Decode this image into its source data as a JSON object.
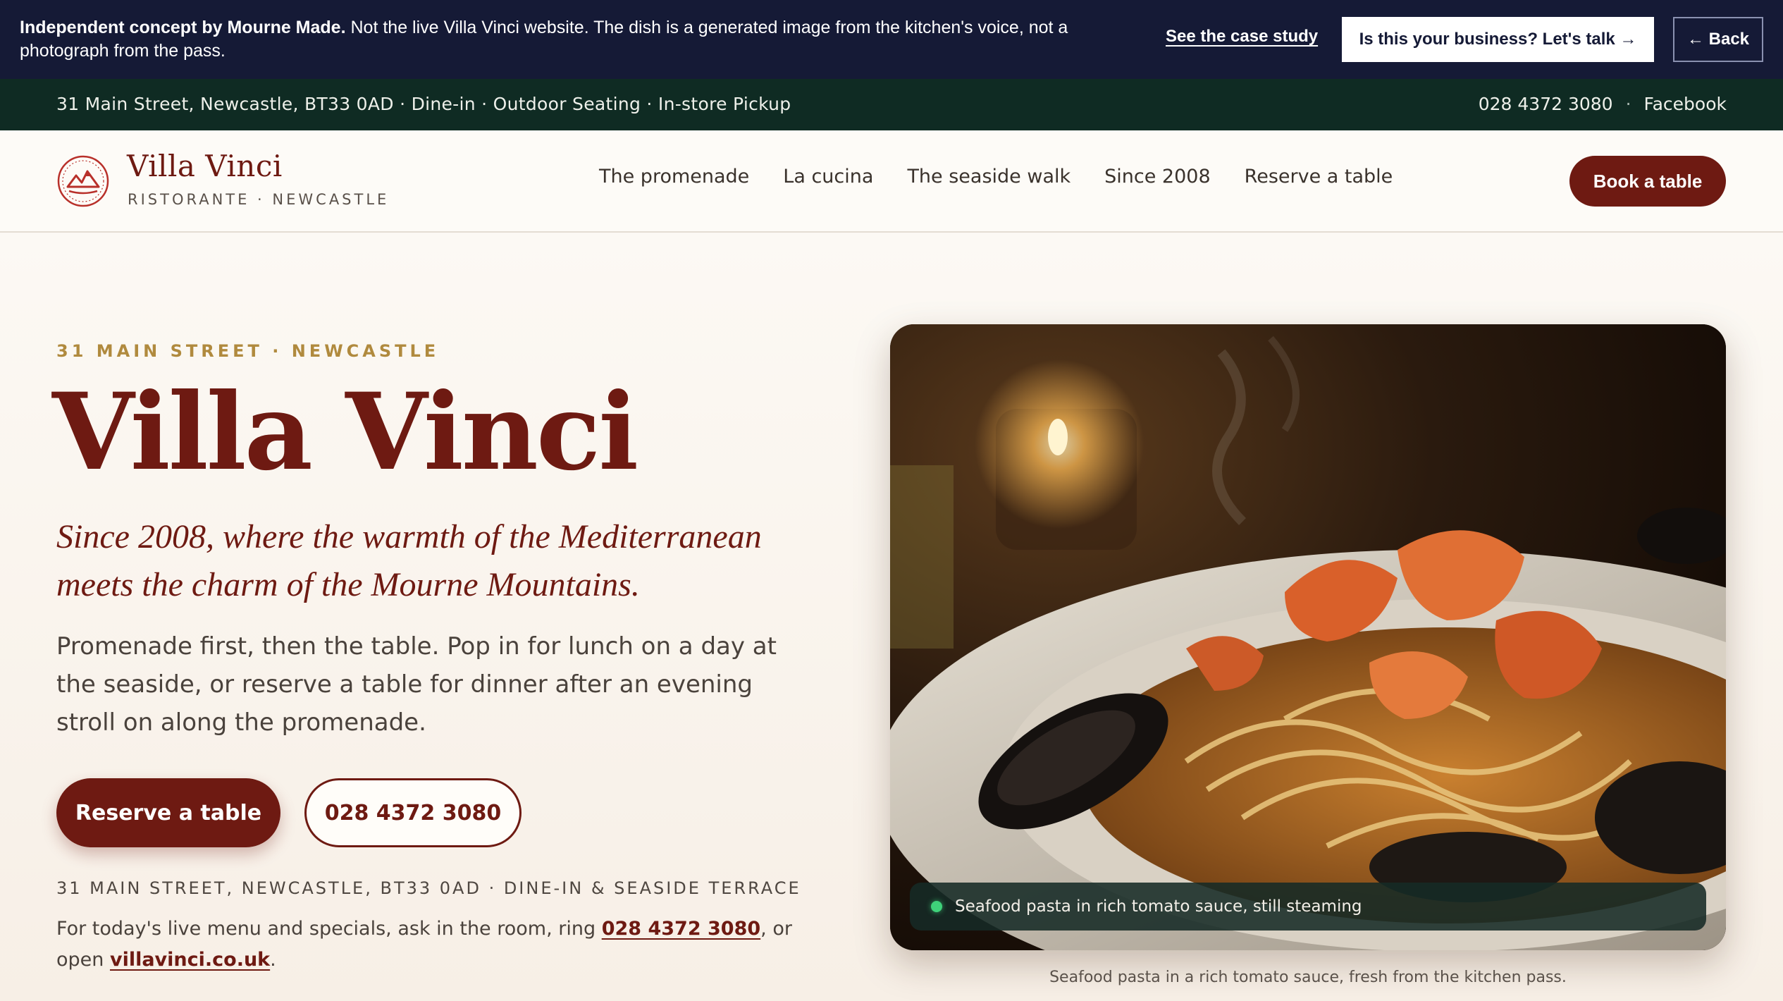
{
  "notice": {
    "bold_text": "Independent concept by Mourne Made.",
    "text": "Not the live Villa Vinci website. The dish is a generated image from the kitchen's voice, not a photograph from the pass.",
    "case_study_link": "See the case study",
    "cta_label": "Is this your business? Let's talk →",
    "back_label": "← Back"
  },
  "infobar": {
    "address_services": "31 Main Street, Newcastle, BT33 0AD · Dine-in · Outdoor Seating · In-store Pickup",
    "phone": "028 4372 3080",
    "separator": "·",
    "social": "Facebook"
  },
  "header": {
    "brand_name": "Villa Vinci",
    "brand_sub": "RISTORANTE · NEWCASTLE",
    "nav": [
      "The promenade",
      "La cucina",
      "The seaside walk",
      "Since 2008",
      "Reserve a table"
    ],
    "book_label": "Book a table"
  },
  "hero": {
    "eyebrow": "31 MAIN STREET · NEWCASTLE",
    "title": "Villa Vinci",
    "tagline": "Since 2008, where the warmth of the Mediterranean meets the charm of the Mourne Mountains.",
    "body": "Promenade first, then the table. Pop in for lunch on a day at the seaside, or reserve a table for dinner after an evening stroll on along the promenade.",
    "primary_button": "Reserve a table",
    "secondary_button": "028 4372 3080",
    "address_line": "31 MAIN STREET, NEWCASTLE, BT33 0AD · DINE-IN & SEASIDE TERRACE",
    "live_note_prefix": "For today's live menu and specials, ask in the room, ring ",
    "live_note_phone": "028 4372 3080",
    "live_note_mid": ", or open ",
    "live_note_site": "villavinci.co.uk",
    "live_note_suffix": "."
  },
  "image": {
    "pill_text": "Seafood pasta in rich tomato sauce, still steaming",
    "caption": "Seafood pasta in a rich tomato sauce, fresh from the kitchen pass."
  },
  "colors": {
    "notice_bg": "#151a36",
    "infobar_bg": "#0f2b23",
    "brand": "#6e1a12",
    "accent_gold": "#b08a3e",
    "status_green": "#3fd27a"
  },
  "icons": [
    "mountain-logo-icon",
    "status-dot-icon"
  ]
}
